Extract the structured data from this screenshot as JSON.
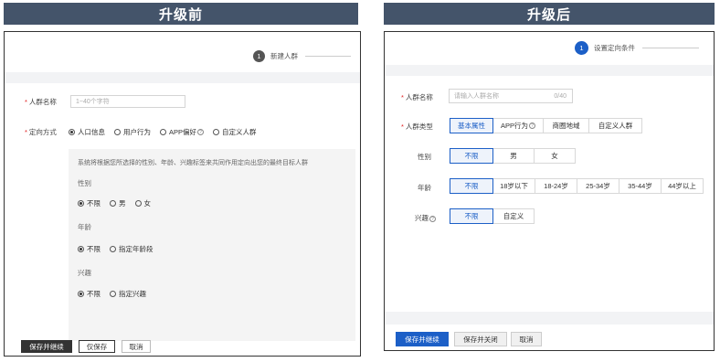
{
  "before": {
    "banner": "升级前",
    "step_number": "1",
    "step_label": "新建人群",
    "name_label": "人群名称",
    "name_placeholder": "1~40个字符",
    "method_label": "定向方式",
    "methods": [
      "人口信息",
      "用户行为",
      "APP偏好",
      "自定义人群"
    ],
    "description": "系统将根据您所选择的性别、年龄、兴趣标签来共同作用定向出您的最终目标人群",
    "gender_title": "性别",
    "gender_options": [
      "不限",
      "男",
      "女"
    ],
    "age_title": "年龄",
    "age_options": [
      "不限",
      "指定年龄段"
    ],
    "interest_title": "兴趣",
    "interest_options": [
      "不限",
      "指定兴趣"
    ],
    "buttons": {
      "save_continue": "保存并继续",
      "save_only": "仅保存",
      "cancel": "取消"
    }
  },
  "after": {
    "banner": "升级后",
    "step_number": "1",
    "step_label": "设置定向条件",
    "name_label": "人群名称",
    "name_placeholder": "请输入人群名称",
    "name_counter": "0/40",
    "type_label": "人群类型",
    "types": [
      "基本属性",
      "APP行为",
      "商圈地域",
      "自定义人群"
    ],
    "gender_label": "性别",
    "gender_options": [
      "不限",
      "男",
      "女"
    ],
    "age_label": "年龄",
    "age_options": [
      "不限",
      "18岁以下",
      "18-24岁",
      "25-34岁",
      "35-44岁",
      "44岁以上"
    ],
    "interest_label": "兴趣",
    "interest_options": [
      "不限",
      "自定义"
    ],
    "buttons": {
      "save_continue": "保存并继续",
      "save_close": "保存并关闭",
      "cancel": "取消"
    }
  },
  "colors": {
    "banner_bg": "#44546a",
    "accent_blue": "#1c5fc7",
    "dark_button": "#333333"
  }
}
